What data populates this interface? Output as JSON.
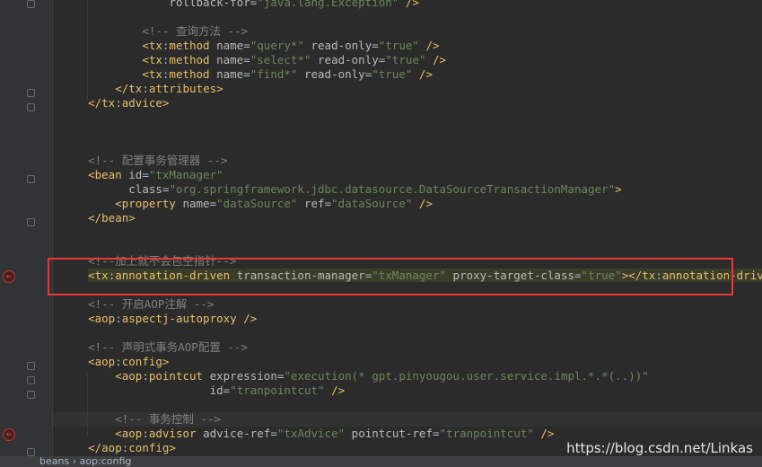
{
  "editor": {
    "lines": [
      {
        "indent": "                ",
        "segments": [
          [
            "a",
            "rollback-for"
          ],
          [
            "p",
            "="
          ],
          [
            "v",
            "\"java.lang.Exception\""
          ],
          [
            "p",
            " "
          ],
          [
            "t",
            "/>"
          ]
        ]
      },
      {
        "indent": "",
        "segments": []
      },
      {
        "indent": "            ",
        "segments": [
          [
            "c",
            "<!-- 查询方法 -->"
          ]
        ]
      },
      {
        "indent": "            ",
        "segments": [
          [
            "t",
            "<tx"
          ],
          [
            "p",
            ":"
          ],
          [
            "t",
            "method "
          ],
          [
            "a",
            "name"
          ],
          [
            "p",
            "="
          ],
          [
            "v",
            "\"query*\""
          ],
          [
            "p",
            " "
          ],
          [
            "a",
            "read-only"
          ],
          [
            "p",
            "="
          ],
          [
            "v",
            "\"true\""
          ],
          [
            "p",
            " "
          ],
          [
            "t",
            "/>"
          ]
        ]
      },
      {
        "indent": "            ",
        "segments": [
          [
            "t",
            "<tx"
          ],
          [
            "p",
            ":"
          ],
          [
            "t",
            "method "
          ],
          [
            "a",
            "name"
          ],
          [
            "p",
            "="
          ],
          [
            "v",
            "\"select*\""
          ],
          [
            "p",
            " "
          ],
          [
            "a",
            "read-only"
          ],
          [
            "p",
            "="
          ],
          [
            "v",
            "\"true\""
          ],
          [
            "p",
            " "
          ],
          [
            "t",
            "/>"
          ]
        ]
      },
      {
        "indent": "            ",
        "segments": [
          [
            "t",
            "<tx"
          ],
          [
            "p",
            ":"
          ],
          [
            "t",
            "method "
          ],
          [
            "a",
            "name"
          ],
          [
            "p",
            "="
          ],
          [
            "v",
            "\"find*\""
          ],
          [
            "p",
            " "
          ],
          [
            "a",
            "read-only"
          ],
          [
            "p",
            "="
          ],
          [
            "v",
            "\"true\""
          ],
          [
            "p",
            " "
          ],
          [
            "t",
            "/>"
          ]
        ]
      },
      {
        "indent": "        ",
        "segments": [
          [
            "t",
            "</tx"
          ],
          [
            "p",
            ":"
          ],
          [
            "t",
            "attributes>"
          ]
        ]
      },
      {
        "indent": "    ",
        "segments": [
          [
            "t",
            "</tx"
          ],
          [
            "p",
            ":"
          ],
          [
            "t",
            "advice>"
          ]
        ]
      },
      {
        "indent": "",
        "segments": []
      },
      {
        "indent": "",
        "segments": []
      },
      {
        "indent": "",
        "segments": []
      },
      {
        "indent": "    ",
        "segments": [
          [
            "c",
            "<!-- 配置事务管理器 -->"
          ]
        ]
      },
      {
        "indent": "    ",
        "segments": [
          [
            "t",
            "<bean "
          ],
          [
            "a",
            "id"
          ],
          [
            "p",
            "="
          ],
          [
            "v",
            "\"txManager\""
          ]
        ]
      },
      {
        "indent": "          ",
        "segments": [
          [
            "a",
            "class"
          ],
          [
            "p",
            "="
          ],
          [
            "v",
            "\"org.springframework.jdbc.datasource.DataSourceTransactionManager\""
          ],
          [
            "t",
            ">"
          ]
        ]
      },
      {
        "indent": "        ",
        "segments": [
          [
            "t",
            "<property "
          ],
          [
            "a",
            "name"
          ],
          [
            "p",
            "="
          ],
          [
            "v",
            "\"dataSource\""
          ],
          [
            "p",
            " "
          ],
          [
            "a",
            "ref"
          ],
          [
            "p",
            "="
          ],
          [
            "v",
            "\"dataSource\""
          ],
          [
            "p",
            " "
          ],
          [
            "t",
            "/>"
          ]
        ]
      },
      {
        "indent": "    ",
        "segments": [
          [
            "t",
            "</bean>"
          ]
        ]
      },
      {
        "indent": "",
        "segments": []
      },
      {
        "indent": "",
        "segments": []
      },
      {
        "indent": "    ",
        "segments": [
          [
            "c",
            "<!--加上就不会包空指针-->"
          ]
        ]
      },
      {
        "indent": "    ",
        "hl": true,
        "segments": [
          [
            "t",
            "<tx"
          ],
          [
            "p",
            ":"
          ],
          [
            "t",
            "annotation-driven "
          ],
          [
            "a",
            "transaction-manager"
          ],
          [
            "p",
            "="
          ],
          [
            "v",
            "\"txManager\""
          ],
          [
            "p",
            " "
          ],
          [
            "a",
            "proxy-target-class"
          ],
          [
            "p",
            "="
          ],
          [
            "v",
            "\"true\""
          ],
          [
            "t",
            "></tx"
          ],
          [
            "p",
            ":"
          ],
          [
            "t",
            "annotation-driven>"
          ]
        ]
      },
      {
        "indent": "",
        "segments": []
      },
      {
        "indent": "    ",
        "segments": [
          [
            "c",
            "<!-- 开启AOP注解 -->"
          ]
        ]
      },
      {
        "indent": "    ",
        "segments": [
          [
            "t",
            "<aop"
          ],
          [
            "p",
            ":"
          ],
          [
            "t",
            "aspectj-autoproxy "
          ],
          [
            "t",
            "/>"
          ]
        ]
      },
      {
        "indent": "",
        "segments": []
      },
      {
        "indent": "    ",
        "segments": [
          [
            "c",
            "<!-- 声明式事务AOP配置 -->"
          ]
        ]
      },
      {
        "indent": "    ",
        "segments": [
          [
            "t",
            "<aop"
          ],
          [
            "p",
            ":"
          ],
          [
            "t",
            "config>"
          ]
        ]
      },
      {
        "indent": "        ",
        "segments": [
          [
            "t",
            "<aop"
          ],
          [
            "p",
            ":"
          ],
          [
            "t",
            "pointcut "
          ],
          [
            "a",
            "expression"
          ],
          [
            "p",
            "="
          ],
          [
            "v",
            "\"execution(* gpt.pinyougou.user.service.impl.*.*(..))\""
          ]
        ]
      },
      {
        "indent": "                      ",
        "segments": [
          [
            "a",
            "id"
          ],
          [
            "p",
            "="
          ],
          [
            "v",
            "\"tranpointcut\""
          ],
          [
            "p",
            " "
          ],
          [
            "t",
            "/>"
          ]
        ]
      },
      {
        "indent": "",
        "segments": []
      },
      {
        "indent": "        ",
        "segments": [
          [
            "c",
            "<!-- 事务控制 -->"
          ]
        ]
      },
      {
        "indent": "        ",
        "segments": [
          [
            "t",
            "<aop"
          ],
          [
            "p",
            ":"
          ],
          [
            "t",
            "advisor "
          ],
          [
            "a",
            "advice-ref"
          ],
          [
            "p",
            "="
          ],
          [
            "v",
            "\"txAdvice\""
          ],
          [
            "p",
            " "
          ],
          [
            "a",
            "pointcut-ref"
          ],
          [
            "p",
            "="
          ],
          [
            "v",
            "\"tranpointcut\""
          ],
          [
            "p",
            " "
          ],
          [
            "t",
            "/>"
          ]
        ]
      },
      {
        "indent": "    ",
        "segments": [
          [
            "t",
            "</aop"
          ],
          [
            "p",
            ":"
          ],
          [
            "t",
            "config>"
          ]
        ]
      }
    ]
  },
  "breadcrumb": "beans  ›  aop:config",
  "watermark": "https://blog.csdn.net/Linkas"
}
